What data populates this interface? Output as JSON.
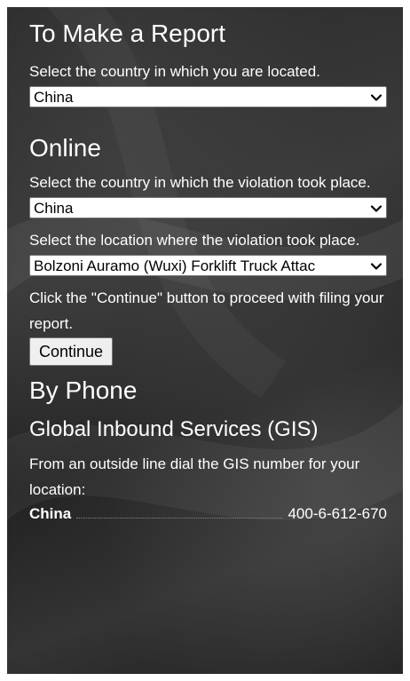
{
  "report": {
    "title": "To Make a Report",
    "country_prompt": "Select the country in which you are located.",
    "country_selected": "China"
  },
  "online": {
    "title": "Online",
    "violation_country_prompt": "Select the country in which the violation took place.",
    "violation_country_selected": "China",
    "location_prompt": "Select the location where the violation took place.",
    "location_selected": "Bolzoni Auramo (Wuxi) Forklift Truck Attac",
    "continue_instruction": "Click the \"Continue\" button to proceed with filing your report.",
    "continue_label": "Continue"
  },
  "phone": {
    "title": "By Phone",
    "service_title": "Global Inbound Services (GIS)",
    "instruction": "From an outside line dial the GIS number for your location:",
    "entries": [
      {
        "country": "China",
        "number": "400-6-612-670"
      }
    ]
  },
  "icons": {
    "dropdown": "chevron-down-icon"
  }
}
